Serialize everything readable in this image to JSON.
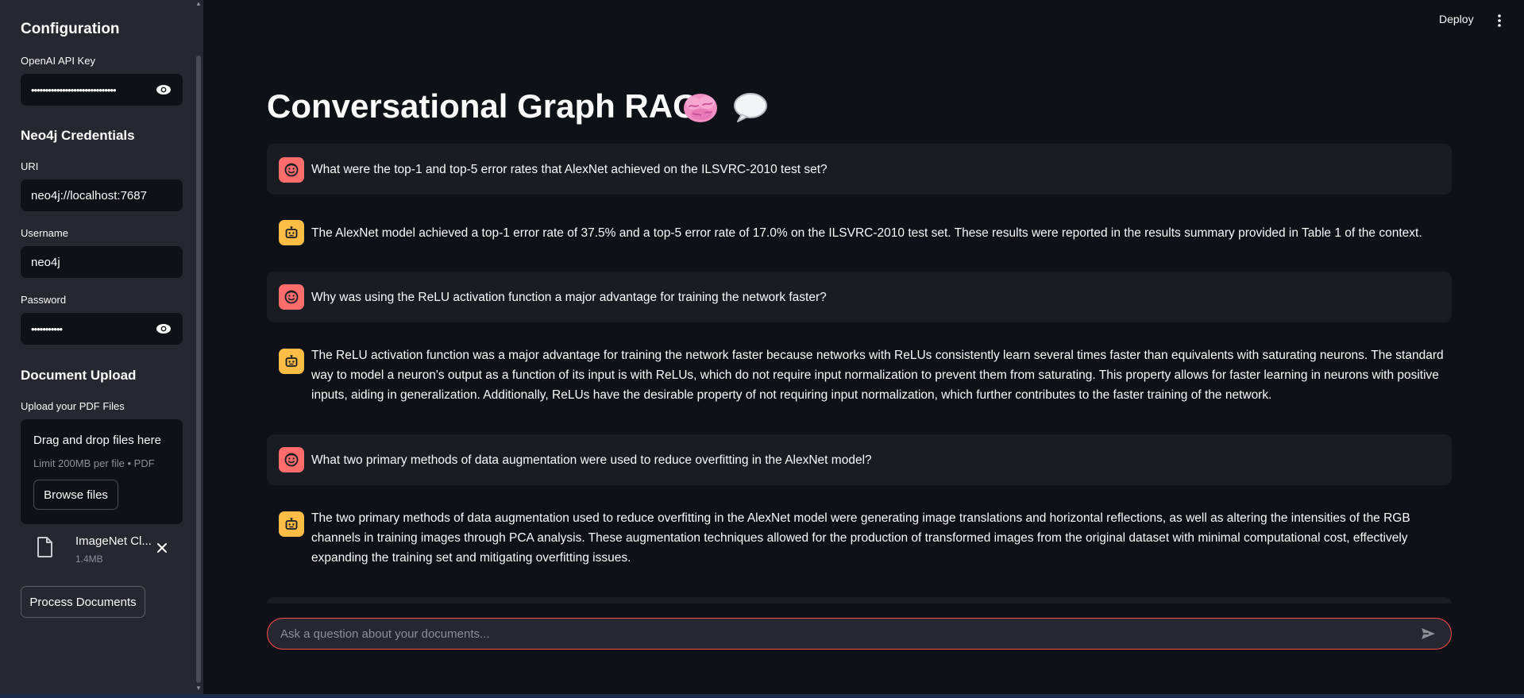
{
  "sidebar": {
    "configuration_heading": "Configuration",
    "api_key_label": "OpenAI API Key",
    "api_key_value": "••••••••••••••••••••••••••••••",
    "neo4j_heading": "Neo4j Credentials",
    "uri_label": "URI",
    "uri_value": "neo4j://localhost:7687",
    "username_label": "Username",
    "username_value": "neo4j",
    "password_label": "Password",
    "password_value": "•••••••••••",
    "upload_heading": "Document Upload",
    "upload_label": "Upload your PDF Files",
    "dropzone_title": "Drag and drop files here",
    "dropzone_limit": "Limit 200MB per file • PDF",
    "browse_button": "Browse files",
    "file_name": "ImageNet Cl...",
    "file_size": "1.4MB",
    "process_button": "Process Documents"
  },
  "topbar": {
    "deploy_label": "Deploy"
  },
  "main": {
    "title": "Conversational Graph RAG",
    "messages": [
      {
        "role": "user",
        "text": "What were the top-1 and top-5 error rates that AlexNet achieved on the ILSVRC-2010 test set?"
      },
      {
        "role": "assistant",
        "text": "The AlexNet model achieved a top-1 error rate of 37.5% and a top-5 error rate of 17.0% on the ILSVRC-2010 test set. These results were reported in the results summary provided in Table 1 of the context."
      },
      {
        "role": "user",
        "text": "Why was using the ReLU activation function a major advantage for training the network faster?"
      },
      {
        "role": "assistant",
        "text": "The ReLU activation function was a major advantage for training the network faster because networks with ReLUs consistently learn several times faster than equivalents with saturating neurons. The standard way to model a neuron's output as a function of its input is with ReLUs, which do not require input normalization to prevent them from saturating. This property allows for faster learning in neurons with positive inputs, aiding in generalization. Additionally, ReLUs have the desirable property of not requiring input normalization, which further contributes to the faster training of the network."
      },
      {
        "role": "user",
        "text": "What two primary methods of data augmentation were used to reduce overfitting in the AlexNet model?"
      },
      {
        "role": "assistant",
        "text": "The two primary methods of data augmentation used to reduce overfitting in the AlexNet model were generating image translations and horizontal reflections, as well as altering the intensities of the RGB channels in training images through PCA analysis. These augmentation techniques allowed for the production of transformed images from the original dataset with minimal computational cost, effectively expanding the training set and mitigating overfitting issues."
      }
    ],
    "chat_placeholder": "Ask a question about your documents..."
  },
  "colors": {
    "background": "#0e1117",
    "sidebar": "#262730",
    "user_avatar": "#ff6c6c",
    "assistant_avatar": "#ffbd45",
    "accent": "#ff4b4b"
  },
  "icons": {
    "user_avatar": "smiley-face-icon",
    "assistant_avatar": "robot-icon",
    "title_emoji_1": "brain-icon",
    "title_emoji_2": "speech-bubble-icon"
  }
}
